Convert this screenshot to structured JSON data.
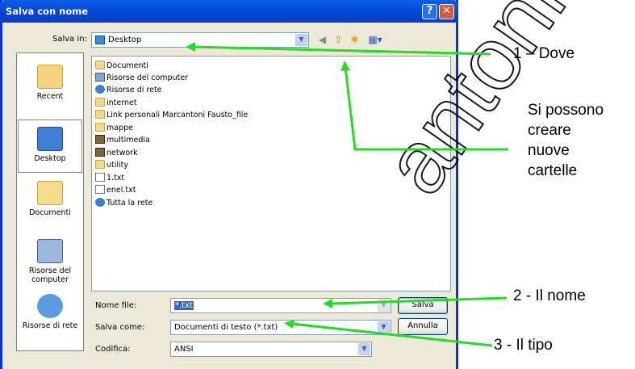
{
  "window": {
    "title": "Salva con nome",
    "help_label": "?",
    "close_label": "✕"
  },
  "save_in": {
    "label": "Salva in:",
    "value": "Desktop"
  },
  "toolbar_icons": [
    "back-icon",
    "up-folder-icon",
    "new-folder-icon",
    "view-menu-icon"
  ],
  "places": [
    {
      "label": "Recent",
      "icon": "recent-folder-icon"
    },
    {
      "label": "Desktop",
      "icon": "desktop-icon"
    },
    {
      "label": "Documenti",
      "icon": "documents-icon"
    },
    {
      "label": "Risorse del computer",
      "icon": "my-computer-icon"
    },
    {
      "label": "Risorse di rete",
      "icon": "network-places-icon"
    }
  ],
  "files": [
    {
      "name": "Documenti",
      "icon": "folder-icon"
    },
    {
      "name": "Risorse del computer",
      "icon": "computer-icon"
    },
    {
      "name": "Risorse di rete",
      "icon": "network-icon"
    },
    {
      "name": "internet",
      "icon": "folder-icon"
    },
    {
      "name": "Link personali Marcantoni Fausto_file",
      "icon": "folder-icon"
    },
    {
      "name": "mappe",
      "icon": "folder-icon"
    },
    {
      "name": "multimedia",
      "icon": "film-folder-icon"
    },
    {
      "name": "network",
      "icon": "network-folder-icon"
    },
    {
      "name": "utility",
      "icon": "folder-icon"
    },
    {
      "name": "1.txt",
      "icon": "text-file-icon"
    },
    {
      "name": "enel.txt",
      "icon": "text-file-icon"
    },
    {
      "name": "Tutta la rete",
      "icon": "globe-icon"
    }
  ],
  "form": {
    "filename_label": "Nome file:",
    "filename_value": "*.txt",
    "filetype_label": "Salva come:",
    "filetype_value": "Documenti di testo (*.txt)",
    "encoding_label": "Codifica:",
    "encoding_value": "ANSI",
    "save_button": "Salva",
    "cancel_button": "Annulla"
  },
  "annotations": {
    "where": "1 – Dove",
    "new_folders": [
      "Si possono",
      "creare",
      "nuove",
      "cartelle"
    ],
    "name": "2 - Il nome",
    "type": "3 - Il tipo",
    "watermark": "antoni"
  },
  "colors": {
    "title_bar": "#0A5FE8",
    "dialog_bg": "#ECE9D8",
    "arrow": "#22DD22"
  }
}
